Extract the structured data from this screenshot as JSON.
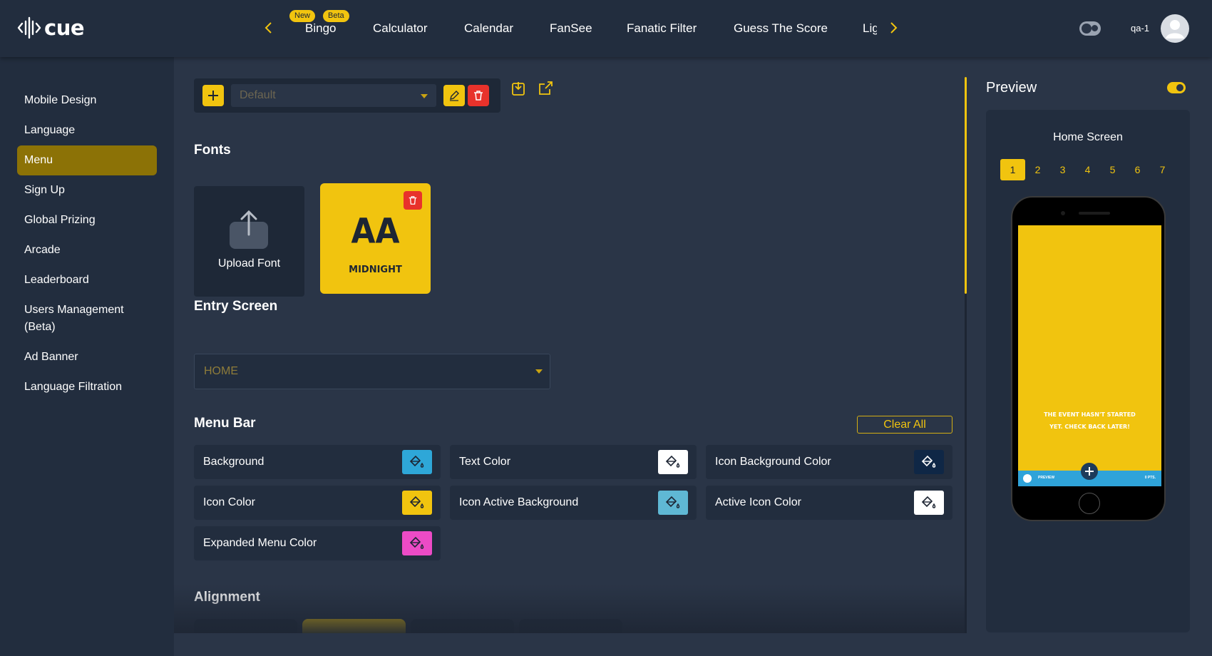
{
  "app": {
    "logo_text": "cue",
    "user": "qa-1"
  },
  "topnav": {
    "tabs": [
      {
        "label": "Bingo",
        "badges": [
          "New",
          "Beta"
        ]
      },
      {
        "label": "Calculator"
      },
      {
        "label": "Calendar"
      },
      {
        "label": "FanSee"
      },
      {
        "label": "Fanatic Filter"
      },
      {
        "label": "Guess The Score"
      },
      {
        "label": "Lig"
      }
    ]
  },
  "sidebar": {
    "items": [
      {
        "label": "Mobile Design"
      },
      {
        "label": "Language"
      },
      {
        "label": "Menu",
        "active": true
      },
      {
        "label": "Sign Up"
      },
      {
        "label": "Global Prizing"
      },
      {
        "label": "Arcade"
      },
      {
        "label": "Leaderboard"
      },
      {
        "label": "Users Management (Beta)"
      },
      {
        "label": "Ad Banner"
      },
      {
        "label": "Language Filtration"
      }
    ]
  },
  "toolbar": {
    "theme_select": "Default"
  },
  "fonts": {
    "title": "Fonts",
    "upload_label": "Upload Font",
    "font_preview": "AA",
    "font_name": "MIDNIGHT"
  },
  "entry_screen": {
    "title": "Entry Screen",
    "value": "HOME"
  },
  "menu_bar": {
    "title": "Menu Bar",
    "clear_all": "Clear All",
    "colors": [
      {
        "label": "Background",
        "color": "#2ea7d8"
      },
      {
        "label": "Text Color",
        "color": "#ffffff"
      },
      {
        "label": "Icon Background Color",
        "color": "#0f2746"
      },
      {
        "label": "Icon Color",
        "color": "#f1c40f"
      },
      {
        "label": "Icon Active Background",
        "color": "#5fb8d4"
      },
      {
        "label": "Active Icon Color",
        "color": "#ffffff"
      },
      {
        "label": "Expanded Menu Color",
        "color": "#ec4bc6"
      }
    ]
  },
  "alignment": {
    "title": "Alignment"
  },
  "preview": {
    "title": "Preview",
    "screen_name": "Home Screen",
    "pages": [
      "1",
      "2",
      "3",
      "4",
      "5",
      "6",
      "7"
    ],
    "active_page": "1",
    "message": "The Event hasn't started yet. Check back later!",
    "bar_left": "PREVIEW",
    "bar_right": "0 PTS."
  },
  "colors": {
    "accent": "#f1c40f",
    "danger": "#e8322b",
    "panel": "#222d3e",
    "background": "#2a3547"
  }
}
